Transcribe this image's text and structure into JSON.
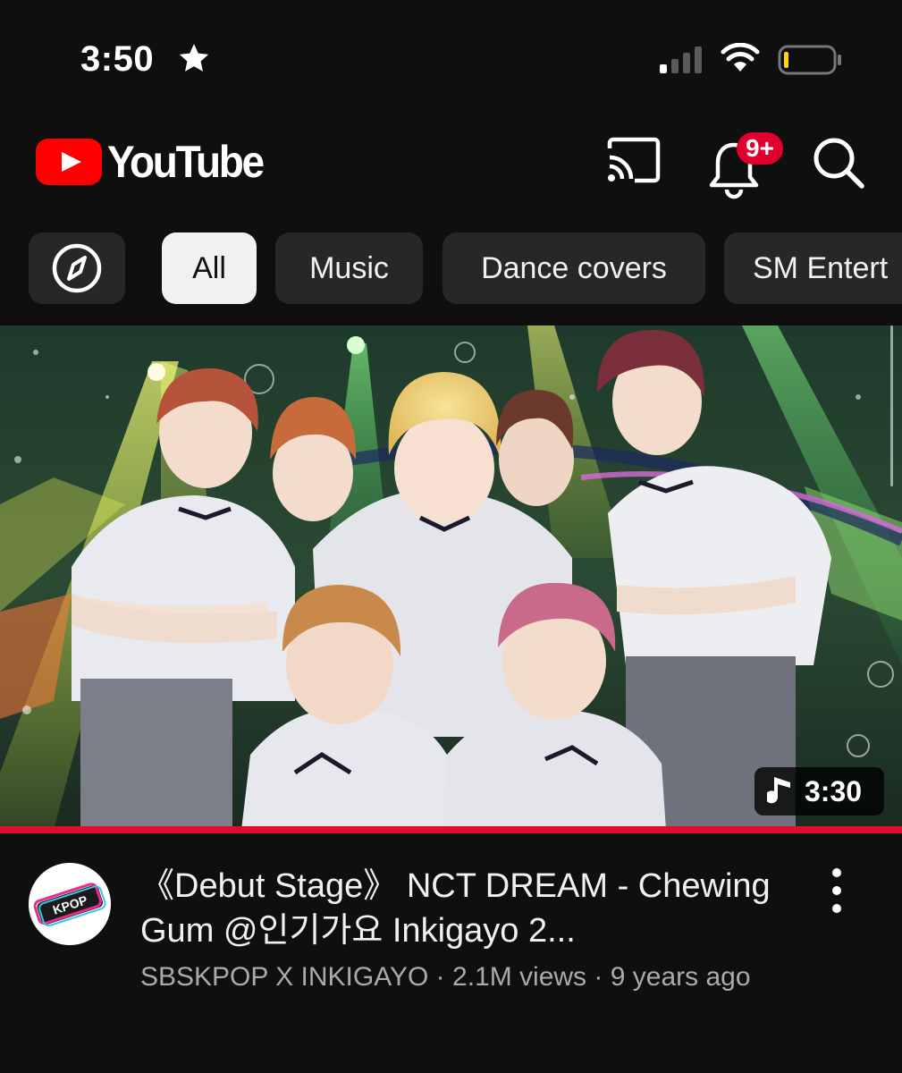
{
  "status_bar": {
    "time": "3:50",
    "icons": [
      "star-icon",
      "signal-icon",
      "wifi-icon",
      "battery-icon"
    ]
  },
  "header": {
    "logo_text": "YouTube",
    "notification_badge": "9+",
    "icons": [
      "youtube-play-icon",
      "cast-icon",
      "bell-icon",
      "search-icon"
    ]
  },
  "chips": {
    "explore_icon": "compass-icon",
    "items": [
      {
        "label": "All",
        "active": true
      },
      {
        "label": "Music",
        "active": false
      },
      {
        "label": "Dance covers",
        "active": false
      },
      {
        "label": "SM Entert",
        "active": false
      }
    ]
  },
  "video": {
    "duration": "3:30",
    "duration_icon": "music-note-icon",
    "progress": 1.0,
    "title": "《Debut Stage》 NCT DREAM - Chewing Gum @인기가요 Inkigayo 2...",
    "channel": "SBSKPOP X INKIGAYO",
    "views": "2.1M views",
    "age": "9 years ago",
    "separator": " · ",
    "avatar_text": "KPOP",
    "more_icon": "more-vertical-icon"
  },
  "colors": {
    "background": "#0f0f0f",
    "brand_red": "#ff0000",
    "progress_red": "#e00d2d",
    "chip_bg": "#272727",
    "chip_active_bg": "#f1f1f1",
    "subtitle_gray": "#aaaaaa"
  }
}
